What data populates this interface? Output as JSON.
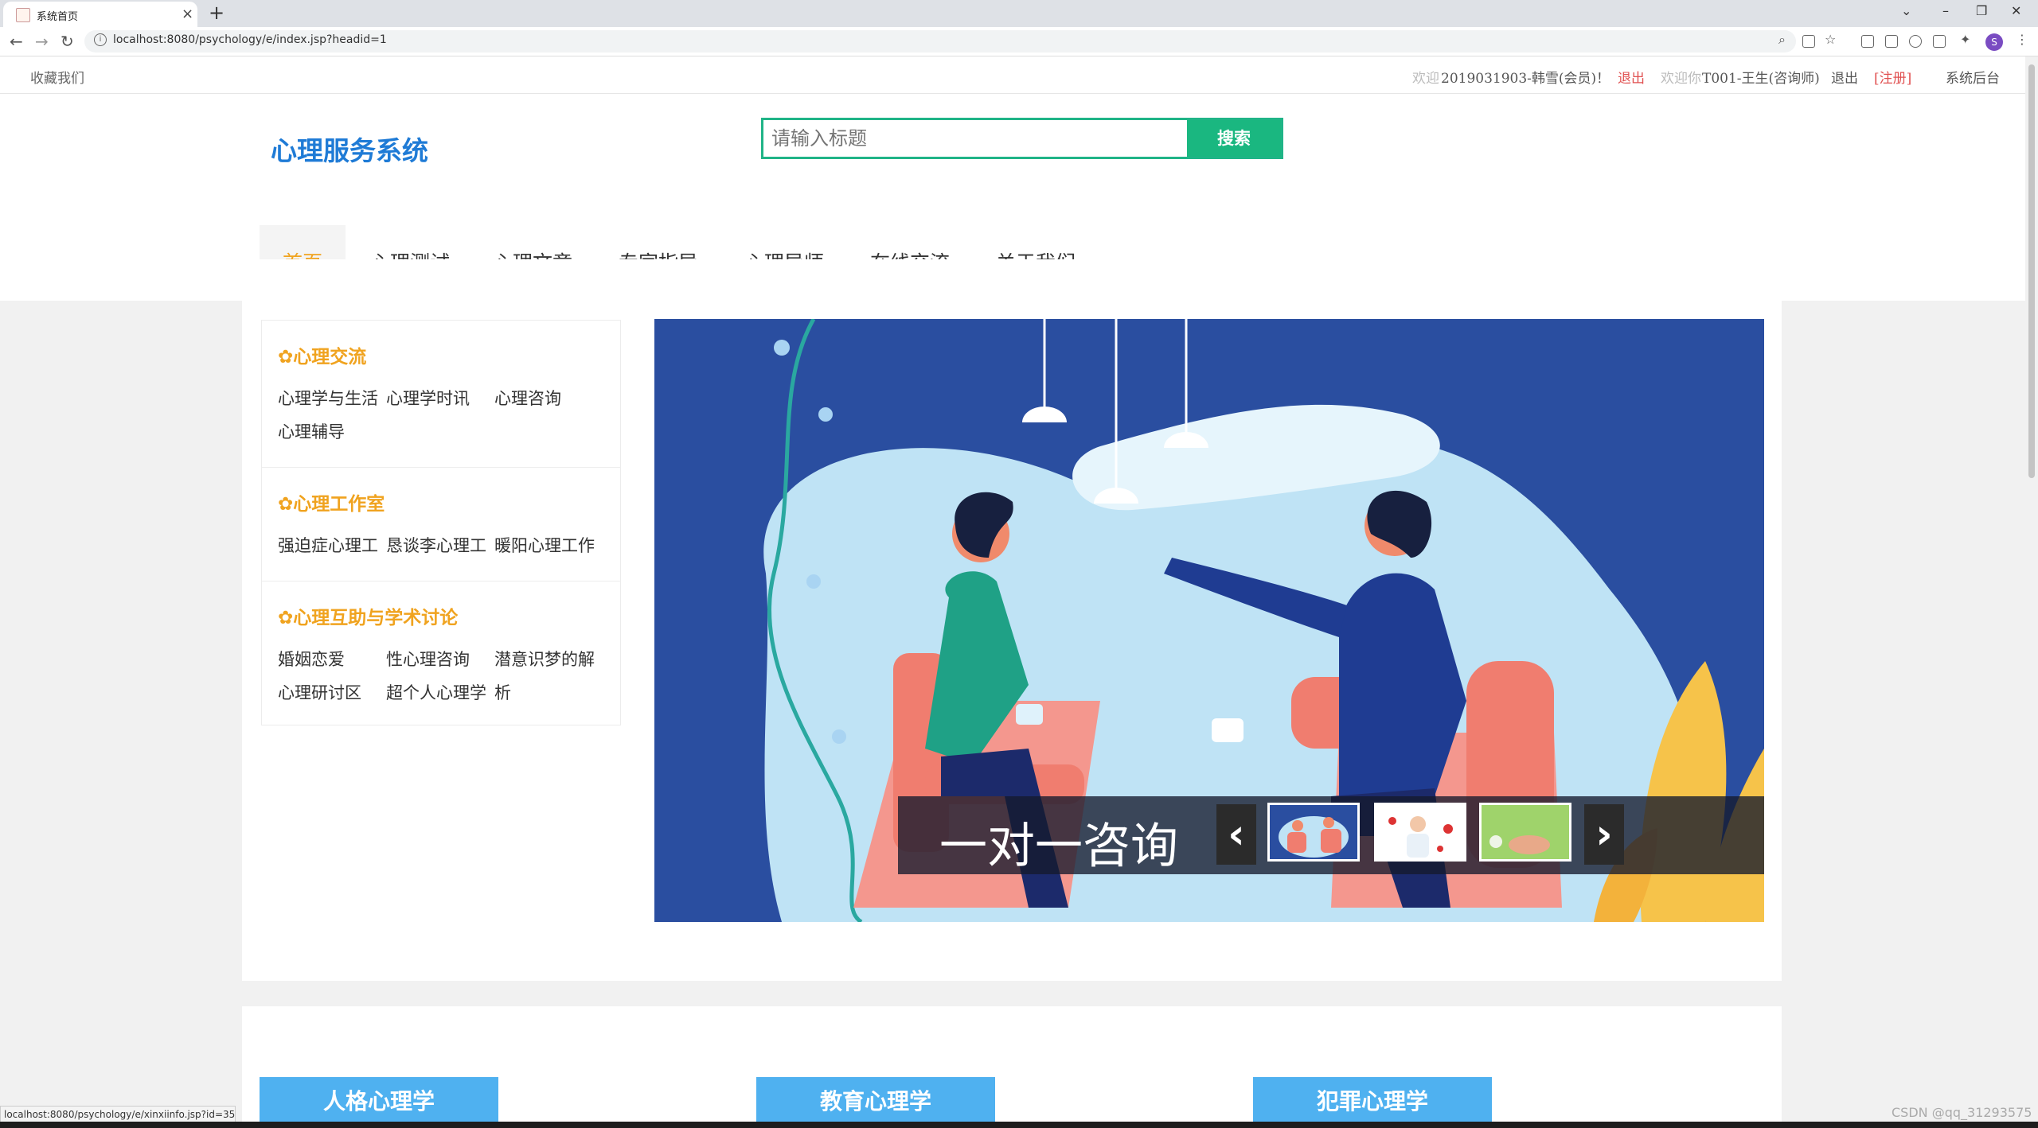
{
  "browser": {
    "tab_title": "系统首页",
    "tab_close": "×",
    "new_tab": "+",
    "url": "localhost:8080/psychology/e/index.jsp?headid=1",
    "win_min": "–",
    "win_max": "❐",
    "win_close": "✕",
    "win_chevron": "⌄",
    "profile_letter": "S"
  },
  "topbar": {
    "bookmark": "收藏我们",
    "welcome_member_prefix": "欢迎",
    "welcome_member": "2019031903-韩雪(会员)！",
    "logout_member": "退出",
    "welcome_counselor_prefix": "欢迎你",
    "welcome_counselor": "T001-王生(咨询师)",
    "logout_counselor": "退出",
    "register": "[注册]",
    "admin": "系统后台"
  },
  "header": {
    "logo": "心理服务系统",
    "search_placeholder": "请输入标题",
    "search_button": "搜索"
  },
  "nav": {
    "items": [
      "首页",
      "心理测试",
      "心理文章",
      "专家指导",
      "心理导师",
      "在线交流",
      "关于我们"
    ]
  },
  "sidebar": {
    "sections": [
      {
        "title": "✿心理交流",
        "links": [
          "心理学与生活",
          "心理学时讯",
          "心理咨询",
          "心理辅导"
        ]
      },
      {
        "title": "✿心理工作室",
        "links": [
          "强迫症心理工",
          "恳谈李心理工",
          "暖阳心理工作"
        ]
      },
      {
        "title": "✿心理互助与学术讨论",
        "links": [
          "婚姻恋爱",
          "性心理咨询",
          "潜意识梦的解",
          "心理研讨区",
          "超个人心理学",
          "析"
        ]
      }
    ]
  },
  "banner": {
    "caption": "一对一咨询",
    "prev": "‹",
    "next": "›"
  },
  "categories": [
    "人格心理学",
    "教育心理学",
    "犯罪心理学"
  ],
  "status_url": "localhost:8080/psychology/e/xinxiinfo.jsp?id=35",
  "watermark": "CSDN @qq_31293575",
  "colors": {
    "accent": "#f0a31f",
    "logo": "#1f7bd6",
    "search": "#1ab780",
    "category_tab": "#4fb1f0",
    "banner_bg": "#2a4ea0"
  }
}
